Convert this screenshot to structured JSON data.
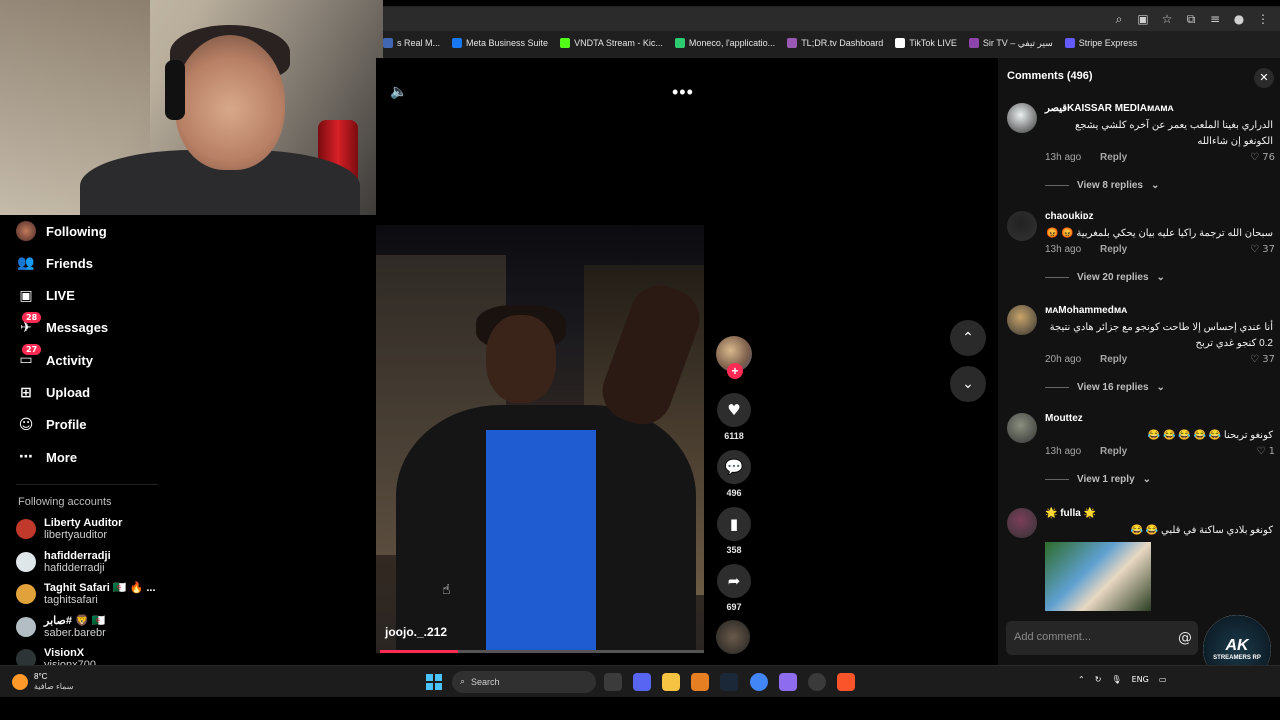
{
  "bookmarks": [
    {
      "label": "s Real M...",
      "color": "#4267b2"
    },
    {
      "label": "Meta Business Suite",
      "color": "#1877f2"
    },
    {
      "label": "VNDTA Stream - Kic...",
      "color": "#53fc18"
    },
    {
      "label": "Moneco, l'applicatio...",
      "color": "#2ecc71"
    },
    {
      "label": "TL;DR.tv Dashboard",
      "color": "#9b59b6"
    },
    {
      "label": "TikTok LIVE",
      "color": "#ffffff"
    },
    {
      "label": "Sir TV – سير تيفي",
      "color": "#8e44ad"
    },
    {
      "label": "Stripe Express",
      "color": "#635bff"
    }
  ],
  "nav": [
    {
      "label": "Following",
      "icon": "avatar"
    },
    {
      "label": "Friends",
      "icon": "friends-icon"
    },
    {
      "label": "LIVE",
      "icon": "live-icon"
    },
    {
      "label": "Messages",
      "icon": "messages-icon",
      "badge": "28"
    },
    {
      "label": "Activity",
      "icon": "activity-icon",
      "badge": "27"
    },
    {
      "label": "Upload",
      "icon": "upload-icon"
    },
    {
      "label": "Profile",
      "icon": "profile-icon"
    },
    {
      "label": "More",
      "icon": "more-icon"
    }
  ],
  "following_heading": "Following accounts",
  "following_accounts": [
    {
      "name": "Liberty Auditor",
      "user": "libertyauditor",
      "color": "#c0392b"
    },
    {
      "name": "hafidderradji",
      "user": "hafidderradji",
      "color": "#dfe6e9",
      "verified": true
    },
    {
      "name": "Taghit Safari 🇩🇿 🔥 ...",
      "user": "taghitsafari",
      "color": "#e1a23b"
    },
    {
      "name": "صابر# 🦁 🇩🇿",
      "user": "saber.barebr",
      "color": "#b2bec3"
    },
    {
      "name": "VisionX",
      "user": "visionx700",
      "color": "#2d3436"
    }
  ],
  "video": {
    "username": "joojo._.212",
    "progress": 0.24
  },
  "actions": {
    "likes": "6118",
    "comments": "496",
    "saves": "358",
    "shares": "697"
  },
  "comments_panel": {
    "title": "Comments (496)",
    "input_placeholder": "Add comment...",
    "comments": [
      {
        "author": "قيصرKAISSAR MEDIAᴍᴀᴍᴀ",
        "text": "الدراري بغينا الملعب يعمر عن آخره كلشي يشجع الكونغو إن شاءالله",
        "time": "13h ago",
        "reply": "Reply",
        "likes": "76",
        "view": "View 8 replies",
        "color": "#ecf0f1"
      },
      {
        "author": "chaoukiᴅᴢ",
        "text": "سبحان الله ترجمة راكيا عليه بيان يحكي بلمغربية 😡 😡",
        "time": "13h ago",
        "reply": "Reply",
        "likes": "37",
        "view": "View 20 replies",
        "color": "#222222"
      },
      {
        "author": "ᴍᴀMohammedᴍᴀ",
        "text": "أنا عندي إحساس إلا طاحت كونجو مع جزائر هادي نتيجة 0.2 كنجو غدي تربح",
        "time": "20h ago",
        "reply": "Reply",
        "likes": "37",
        "view": "View 16 replies",
        "color": "#c8a46a"
      },
      {
        "author": "Mouttez",
        "text": "كونغو تربحنا 😂 😂 😂 😂 😂",
        "time": "13h ago",
        "reply": "Reply",
        "likes": "1",
        "view": "View 1 reply",
        "color": "#8a8f80"
      },
      {
        "author": "🌟 fulla 🌟",
        "text": "كونغو بلادي ساكنة في قلبي 😂 😂",
        "color": "#7a3e5a"
      }
    ]
  },
  "stream_logo": {
    "main": "AK",
    "sub": "STREAMERS RP"
  },
  "taskbar": {
    "temp": "8°C",
    "weather": "سماء صافية",
    "search": "Search",
    "lang": "ENG"
  }
}
